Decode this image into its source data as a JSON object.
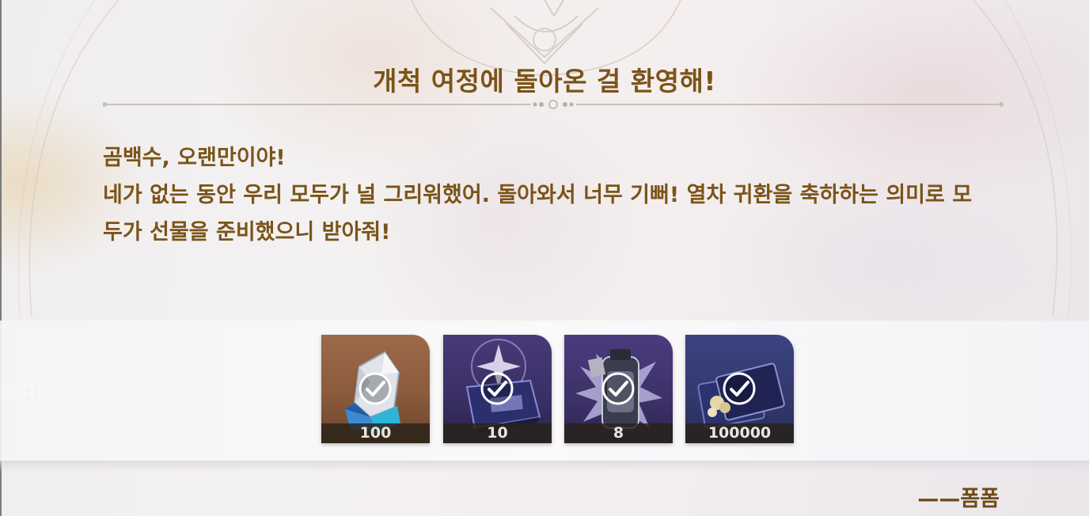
{
  "dialog": {
    "title": "개척 여정에 돌아온 걸 환영해!",
    "message_lines": [
      "곰백수, 오랜만이야!",
      "네가 없는 동안 우리 모두가 널 그리워했어. 돌아와서 너무 기뻐! 열차 귀환을 축하하는 의미로 모",
      "두가 선물을 준비했으니 받아줘!"
    ],
    "signature": "——폼폼"
  },
  "rewards": [
    {
      "icon": "stellar-jade-icon",
      "quantity": "100",
      "claimed": true
    },
    {
      "icon": "exp-book-icon",
      "quantity": "10",
      "claimed": true
    },
    {
      "icon": "fuel-canister-icon",
      "quantity": "8",
      "claimed": true
    },
    {
      "icon": "credit-card-icon",
      "quantity": "100000",
      "claimed": true
    }
  ],
  "colors": {
    "text_gold": "#7a5418",
    "quantity_bar": "#28221a"
  }
}
